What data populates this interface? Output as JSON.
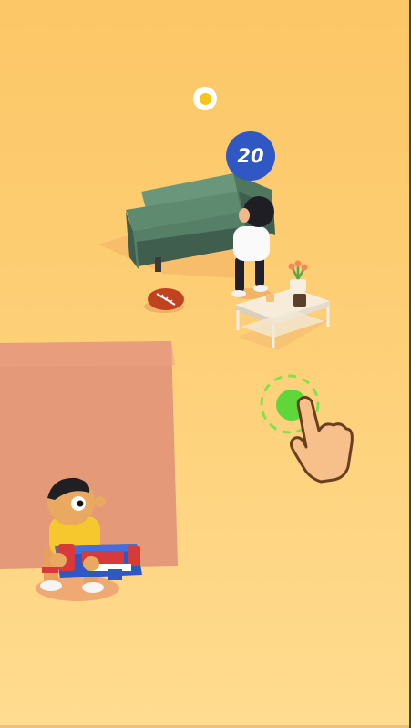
{
  "hud": {
    "score_value": "20",
    "coin_icon": "gold-coin-icon"
  },
  "colors": {
    "background": "#fdcd72",
    "score_badge": "#2f58c4",
    "coin": "#f5c518",
    "target_ring": "#7de44e",
    "target_dot": "#5fd63a",
    "sofa": "#6a977c",
    "zone": "#e49a78"
  },
  "objects": {
    "player": "player-character-with-blaster",
    "enemy": "enemy-character",
    "football": "football-icon",
    "plant": "flower-pot-icon",
    "hand": "tap-hand-icon"
  }
}
